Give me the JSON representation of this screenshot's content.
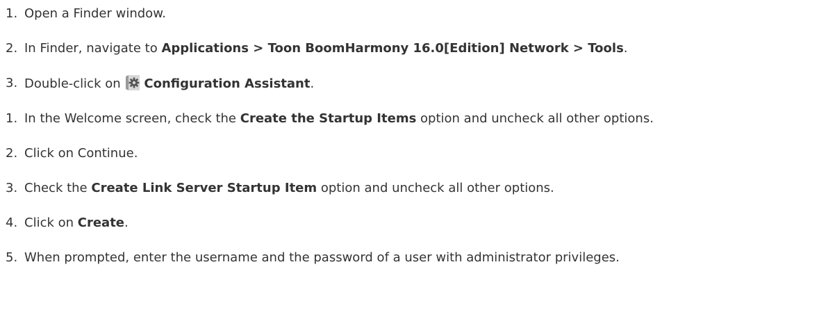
{
  "steps": [
    {
      "number": "1.",
      "segments": [
        {
          "text": "Open a Finder window.",
          "bold": false
        }
      ]
    },
    {
      "number": "2.",
      "segments": [
        {
          "text": "In Finder, navigate to ",
          "bold": false
        },
        {
          "text": "Applications > Toon BoomHarmony 16.0[Edition] Network > Tools",
          "bold": true
        },
        {
          "text": ".",
          "bold": false
        }
      ]
    },
    {
      "number": "3.",
      "segments": [
        {
          "text": "Double-click on ",
          "bold": false
        },
        {
          "icon": "configuration-assistant-icon"
        },
        {
          "text": "Configuration Assistant",
          "bold": true
        },
        {
          "text": ".",
          "bold": false
        }
      ]
    },
    {
      "number": "1.",
      "segments": [
        {
          "text": "In the Welcome screen, check the ",
          "bold": false
        },
        {
          "text": "Create the Startup Items",
          "bold": true
        },
        {
          "text": " option and uncheck all other options.",
          "bold": false
        }
      ]
    },
    {
      "number": "2.",
      "segments": [
        {
          "text": "Click on Continue.",
          "bold": false
        }
      ]
    },
    {
      "number": "3.",
      "segments": [
        {
          "text": "Check the ",
          "bold": false
        },
        {
          "text": "Create Link Server Startup Item",
          "bold": true
        },
        {
          "text": " option and uncheck all other options.",
          "bold": false
        }
      ]
    },
    {
      "number": "4.",
      "segments": [
        {
          "text": "Click on ",
          "bold": false
        },
        {
          "text": "Create",
          "bold": true
        },
        {
          "text": ".",
          "bold": false
        }
      ]
    },
    {
      "number": "5.",
      "segments": [
        {
          "text": "When prompted, enter the username and the password of a user with administrator privileges.",
          "bold": false
        }
      ]
    }
  ],
  "colors": {
    "text": "#333333",
    "background": "#ffffff",
    "icon_base": "#d8d8d8",
    "icon_gear": "#555555"
  }
}
